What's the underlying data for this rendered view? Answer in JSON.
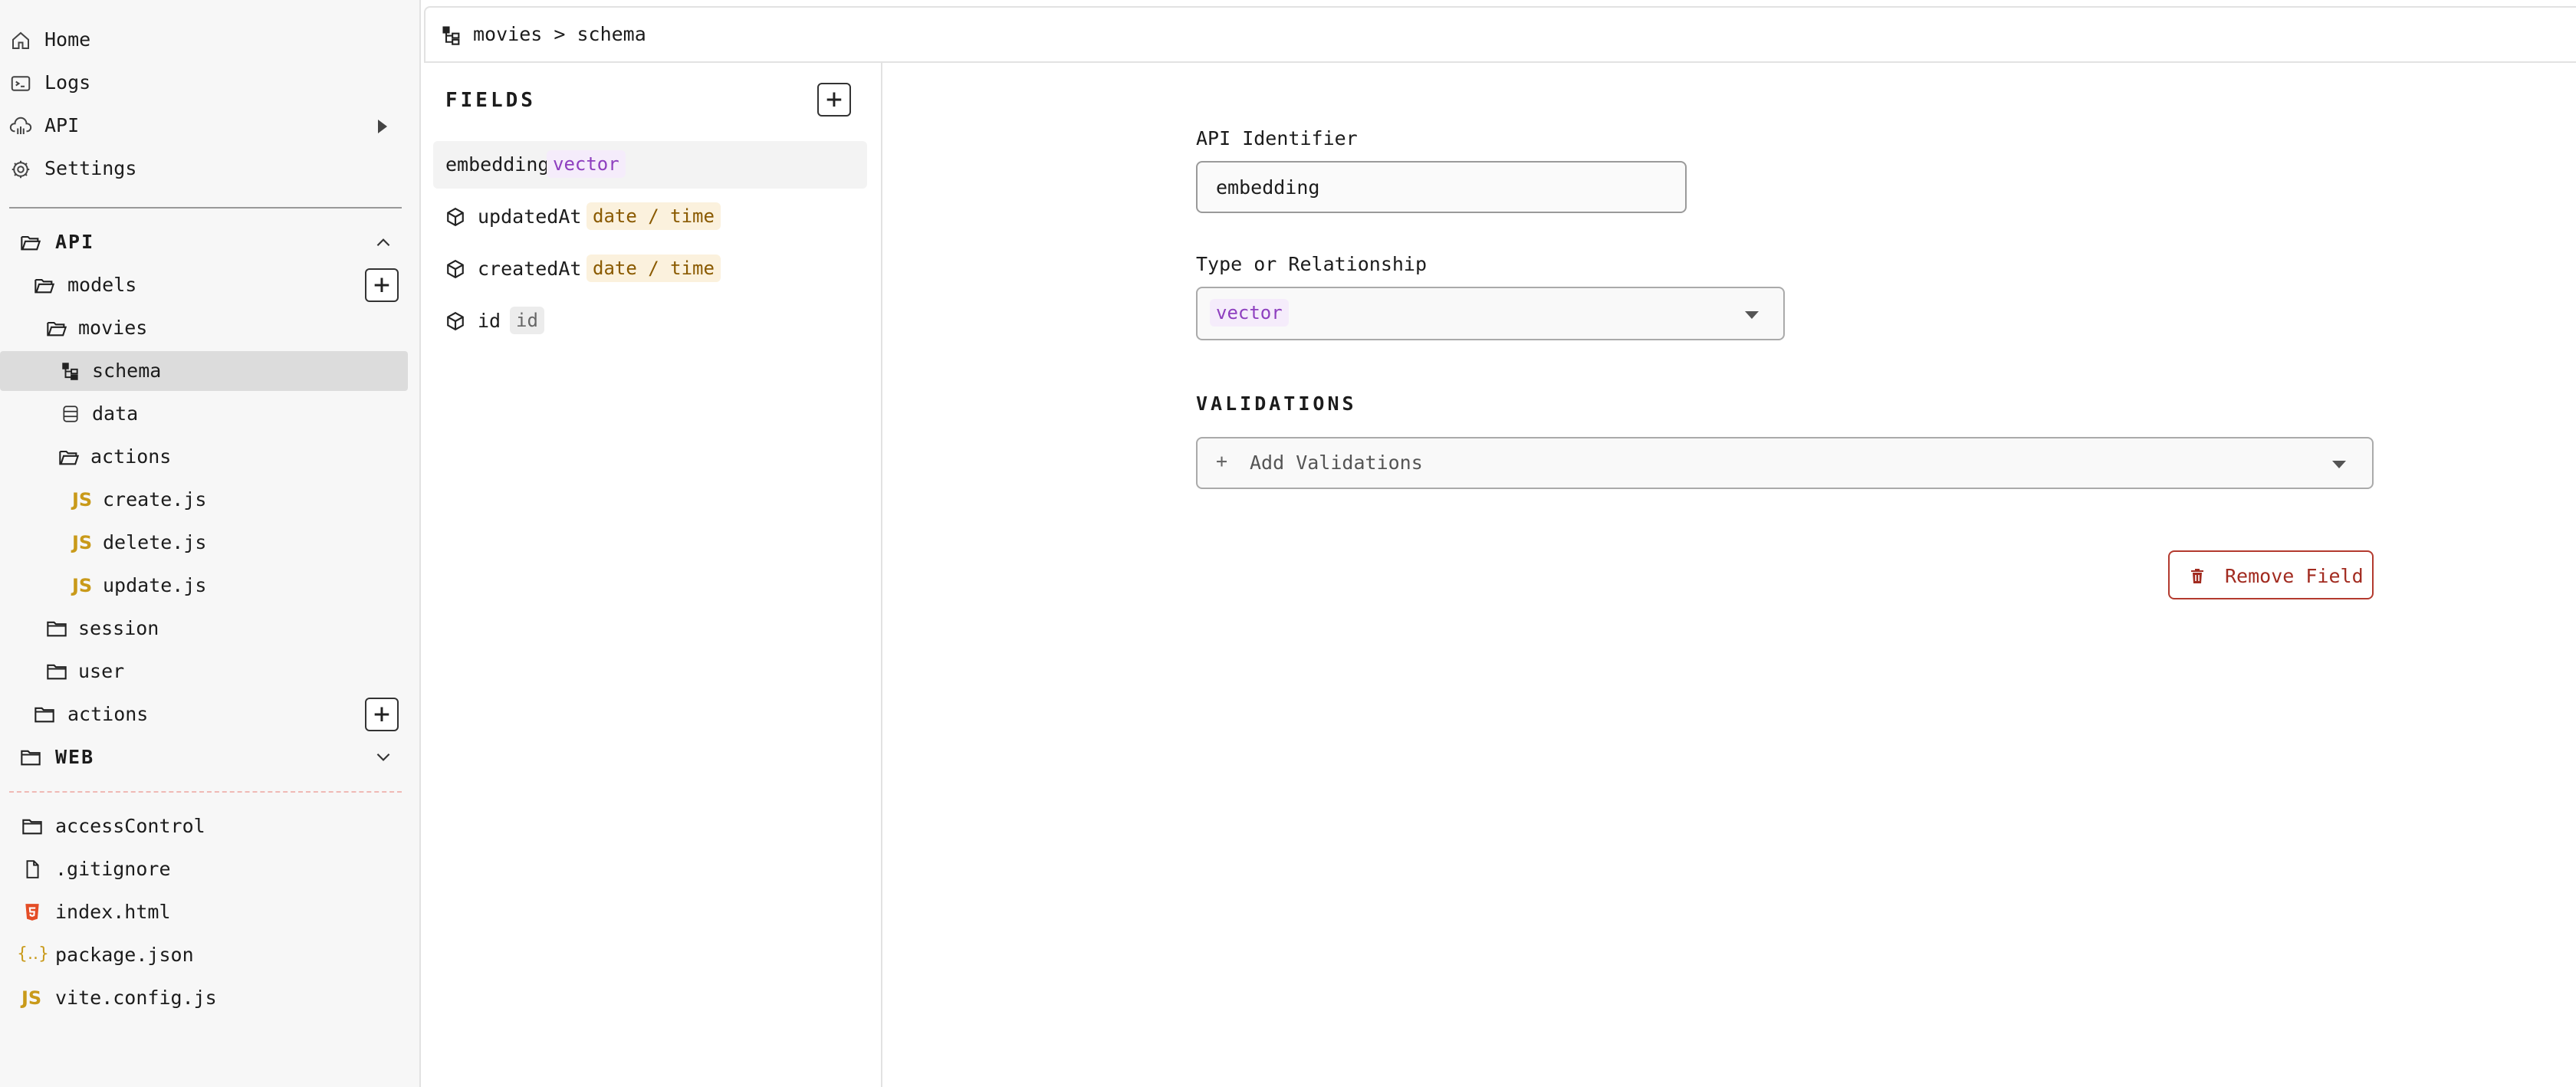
{
  "nav": {
    "home": "Home",
    "logs": "Logs",
    "api": "API",
    "settings": "Settings"
  },
  "tree": {
    "api_section": "API",
    "models": "models",
    "movies": "movies",
    "schema": "schema",
    "data": "data",
    "actions_inner": "actions",
    "js_badge": "JS",
    "create": "create.js",
    "delete": "delete.js",
    "update": "update.js",
    "session": "session",
    "user": "user",
    "actions": "actions",
    "web_section": "WEB",
    "access_control": "accessControl",
    "gitignore": ".gitignore",
    "index_html": "index.html",
    "package_json": "package.json",
    "package_icon": "{..}",
    "vite_config": "vite.config.js"
  },
  "header": {
    "breadcrumb": "movies > schema"
  },
  "fields": {
    "title": "FIELDS",
    "add": "+",
    "items": [
      {
        "name": "embedding",
        "type": "vector"
      },
      {
        "name": "updatedAt",
        "type": "date / time"
      },
      {
        "name": "createdAt",
        "type": "date / time"
      },
      {
        "name": "id",
        "type": "id"
      }
    ]
  },
  "form": {
    "api_identifier_label": "API Identifier",
    "api_identifier_value": "embedding",
    "type_label": "Type or Relationship",
    "type_value": "vector",
    "validations_title": "VALIDATIONS",
    "add_validations": "Add Validations",
    "add_validations_plus": "+",
    "remove_field": "Remove Field"
  },
  "colors": {
    "accent_danger": "#a22b20",
    "vector_tag": "#8e3fbf",
    "date_tag": "#8a5a00",
    "js": "#c99a1a",
    "html5": "#e44d26"
  },
  "icons": [
    "home-icon",
    "terminal-icon",
    "cloud-api-icon",
    "gear-icon",
    "folder-open-icon",
    "folder-icon",
    "schema-icon",
    "database-icon",
    "file-icon",
    "html5-icon",
    "json-icon",
    "cube-icon",
    "trash-icon",
    "chevron-up-icon",
    "chevron-down-icon",
    "caret-down-icon"
  ]
}
